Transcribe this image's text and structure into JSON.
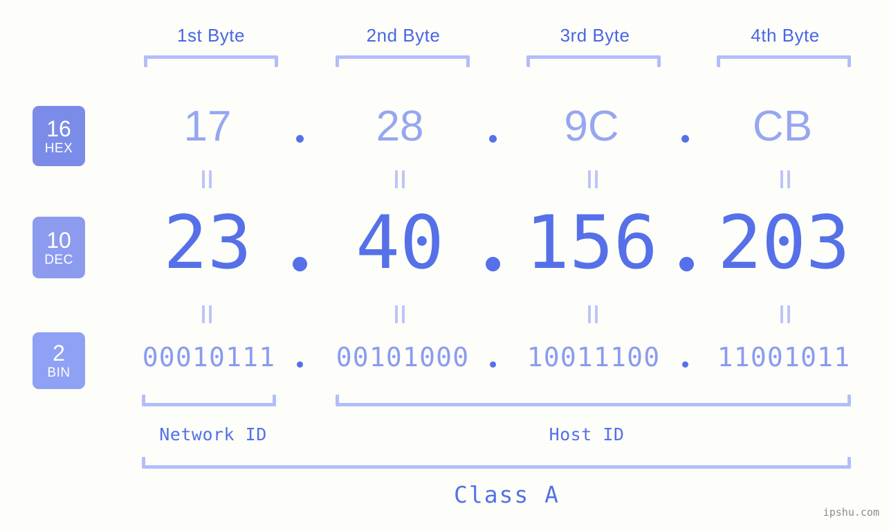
{
  "meta": {
    "background_color": "#fdfefa",
    "accent_color": "#5570e8",
    "accent_light_color": "#b3bdfb",
    "watermark": "ipshu.com"
  },
  "byte_headers": [
    {
      "label": "1st Byte"
    },
    {
      "label": "2nd Byte"
    },
    {
      "label": "3rd Byte"
    },
    {
      "label": "4th Byte"
    }
  ],
  "bases": {
    "hex": {
      "num": "16",
      "name": "HEX",
      "color": "#7b8ce8"
    },
    "dec": {
      "num": "10",
      "name": "DEC",
      "color": "#8c9bee"
    },
    "bin": {
      "num": "2",
      "name": "BIN",
      "color": "#8fa1f4"
    }
  },
  "rows": {
    "hex": {
      "values": [
        "17",
        "28",
        "9C",
        "CB"
      ],
      "separator": "."
    },
    "dec": {
      "values": [
        "23",
        "40",
        "156",
        "203"
      ],
      "separator": "."
    },
    "bin": {
      "values": [
        "00010111",
        "00101000",
        "10011100",
        "11001011"
      ],
      "separator": "."
    }
  },
  "equality_marks": {
    "symbol": "=",
    "count_per_row": 4
  },
  "segments": {
    "network_id": "Network ID",
    "host_id": "Host ID",
    "class": "Class A"
  }
}
